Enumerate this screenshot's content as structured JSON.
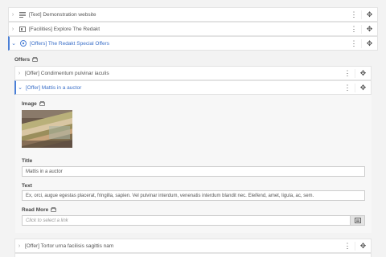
{
  "rows": {
    "text_demo": {
      "label": "[Text] Demonstration website"
    },
    "facilities": {
      "label": "[Facilities] Explore The Redakt"
    },
    "offers": {
      "label": "[Offers] The Redakt Special Offers"
    }
  },
  "offers_section": {
    "label": "Offers"
  },
  "offer_items": {
    "offer1": {
      "label": "[Offer] Condimentum pulvinar iaculis"
    },
    "offer2": {
      "label": "[Offer] Mattis in a auctor"
    },
    "offer3": {
      "label": "[Offer] Tortor urna facilisis sagittis nam"
    }
  },
  "fields": {
    "image": {
      "label": "Image"
    },
    "title": {
      "label": "Title",
      "value": "Mattis in a auctor"
    },
    "text": {
      "label": "Text",
      "value": "Ex, orci, augue egestas placerat, fringilla, sapien. Vel pulvinar interdum, venenatis interdum blandit nec. Eleifend, amet, ligula, ac, sem."
    },
    "read_more": {
      "label": "Read More",
      "placeholder": "Click to select a link"
    }
  },
  "icons": {
    "expand": "chevron-right-icon",
    "collapse": "chevron-down-icon",
    "more": "more-vertical-icon",
    "move": "drag-move-icon",
    "folder": "folder-icon",
    "link_picker": "link-picker-icon"
  },
  "colors": {
    "accent": "#4a7fd6",
    "background": "#f3f3f3"
  }
}
